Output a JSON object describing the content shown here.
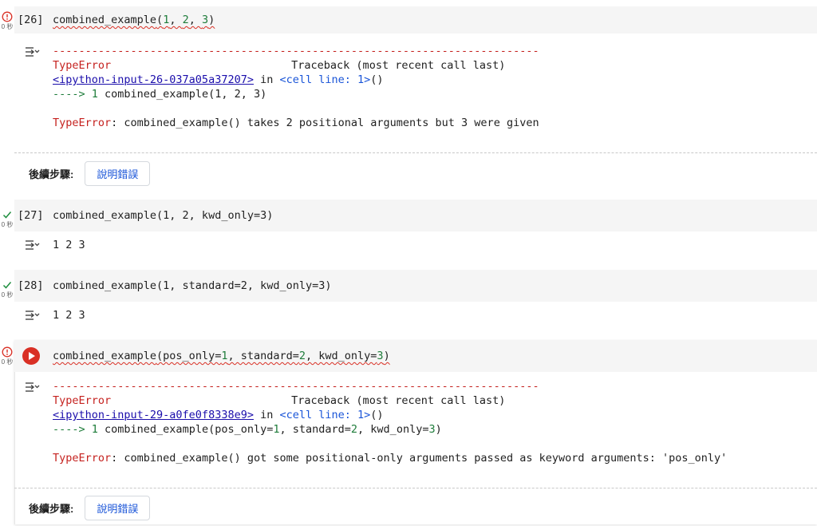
{
  "cells": [
    {
      "status": "error",
      "time": "0 秒",
      "exec_count": "[26]",
      "code": {
        "fn": "combined_example",
        "args_pre": "(",
        "a1": "1",
        "sep1": ", ",
        "a2": "2",
        "sep2": ", ",
        "a3": "3",
        "close": ")"
      },
      "output": {
        "dashes": "---------------------------------------------------------------------------",
        "err_type": "TypeError",
        "traceback_label": "Traceback (most recent call last)",
        "link_text": "<ipython-input-26-037a05a37207>",
        "in_text": " in ",
        "cell_line": "<cell line: 1>",
        "cell_line_paren": "()",
        "arrow": "---->",
        "line_no": " 1 ",
        "line_code": "combined_example(1, 2, 3)",
        "err_prefix": "TypeError",
        "err_msg": ": combined_example() takes 2 positional arguments but 3 were given"
      },
      "next_steps_label": "後續步驟:",
      "explain_label": "說明錯誤"
    },
    {
      "status": "ok",
      "time": "0 秒",
      "exec_count": "[27]",
      "code_text": "combined_example(1, 2, kwd_only=3)",
      "output_text": "1 2 3"
    },
    {
      "status": "ok",
      "time": "0 秒",
      "exec_count": "[28]",
      "code_text": "combined_example(1, standard=2, kwd_only=3)",
      "output_text": "1 2 3"
    },
    {
      "status": "error",
      "time": "0 秒",
      "code": {
        "fn": "combined_example",
        "p1": "(pos_only=",
        "v1": "1",
        "p2": ", standard=",
        "v2": "2",
        "p3": ", kwd_only=",
        "v3": "3",
        "close": ")"
      },
      "output": {
        "dashes": "---------------------------------------------------------------------------",
        "err_type": "TypeError",
        "traceback_label": "Traceback (most recent call last)",
        "link_text": "<ipython-input-29-a0fe0f8338e9>",
        "in_text": " in ",
        "cell_line": "<cell line: 1>",
        "cell_line_paren": "()",
        "arrow": "---->",
        "line_no": " 1 ",
        "line_code_fn": "combined_example(pos_only=",
        "lc_v1": "1",
        "lc_p2": ", standard=",
        "lc_v2": "2",
        "lc_p3": ", kwd_only=",
        "lc_v3": "3",
        "lc_close": ")",
        "err_prefix": "TypeError",
        "err_msg": ": combined_example() got some positional-only arguments passed as keyword arguments: 'pos_only'"
      },
      "next_steps_label": "後續步驟:",
      "explain_label": "說明錯誤"
    }
  ],
  "colors": {
    "error": "#d93025",
    "ok": "#1e8e3e",
    "link": "#1a0dab",
    "number": "#1e7c3a"
  }
}
